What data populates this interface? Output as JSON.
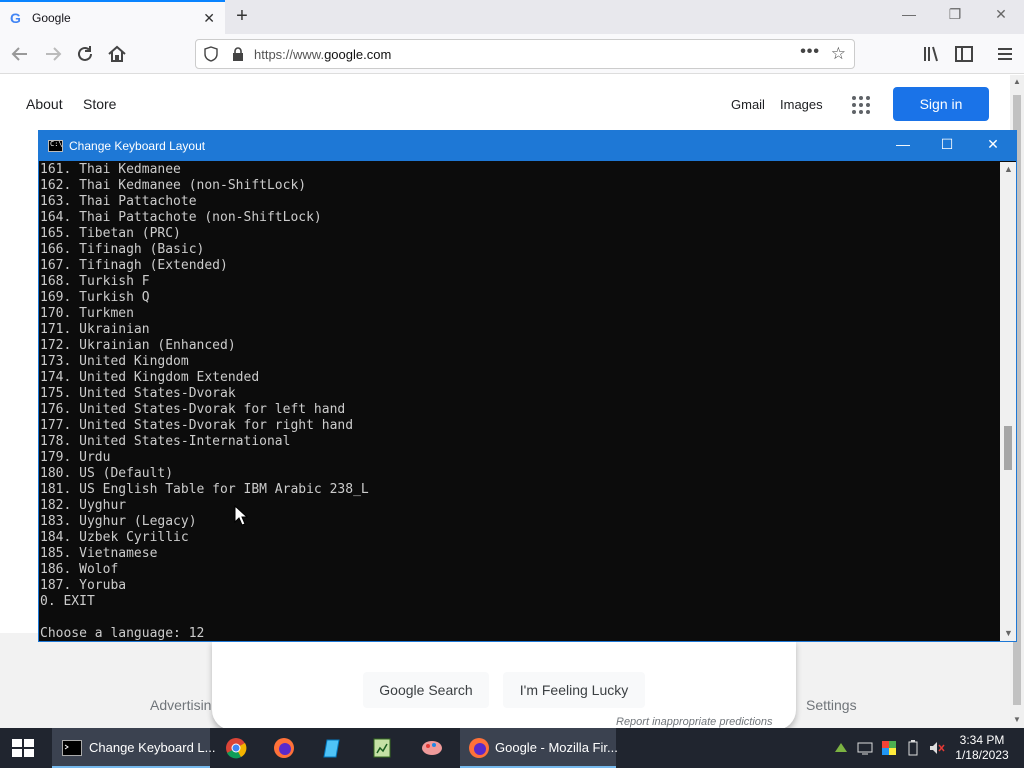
{
  "browser": {
    "tab_title": "Google",
    "url_host": "https://www.",
    "url_domain": "google.com"
  },
  "google": {
    "top_left_links": [
      "About",
      "Store"
    ],
    "top_right_links": [
      "Gmail",
      "Images"
    ],
    "sign_in": "Sign in",
    "search_button": "Google Search",
    "lucky_button": "I'm Feeling Lucky",
    "report": "Report inappropriate predictions",
    "footer_left": "Advertisin",
    "footer_right": "Settings"
  },
  "console": {
    "title": "Change Keyboard Layout",
    "lines": [
      "161. Thai Kedmanee",
      "162. Thai Kedmanee (non-ShiftLock)",
      "163. Thai Pattachote",
      "164. Thai Pattachote (non-ShiftLock)",
      "165. Tibetan (PRC)",
      "166. Tifinagh (Basic)",
      "167. Tifinagh (Extended)",
      "168. Turkish F",
      "169. Turkish Q",
      "170. Turkmen",
      "171. Ukrainian",
      "172. Ukrainian (Enhanced)",
      "173. United Kingdom",
      "174. United Kingdom Extended",
      "175. United States-Dvorak",
      "176. United States-Dvorak for left hand",
      "177. United States-Dvorak for right hand",
      "178. United States-International",
      "179. Urdu",
      "180. US (Default)",
      "181. US English Table for IBM Arabic 238_L",
      "182. Uyghur",
      "183. Uyghur (Legacy)",
      "184. Uzbek Cyrillic",
      "185. Vietnamese",
      "186. Wolof",
      "187. Yoruba",
      "0. EXIT",
      "",
      "Choose a language: 12"
    ]
  },
  "taskbar": {
    "console_item": "Change Keyboard L...",
    "firefox_item": "Google - Mozilla Fir...",
    "time": "3:34 PM",
    "date": "1/18/2023"
  },
  "colors": {
    "accent": "#1e78d6",
    "google_blue": "#1a73e8",
    "console_bg": "#0c0c0c",
    "console_text": "#cccccc",
    "taskbar": "#20252f"
  }
}
